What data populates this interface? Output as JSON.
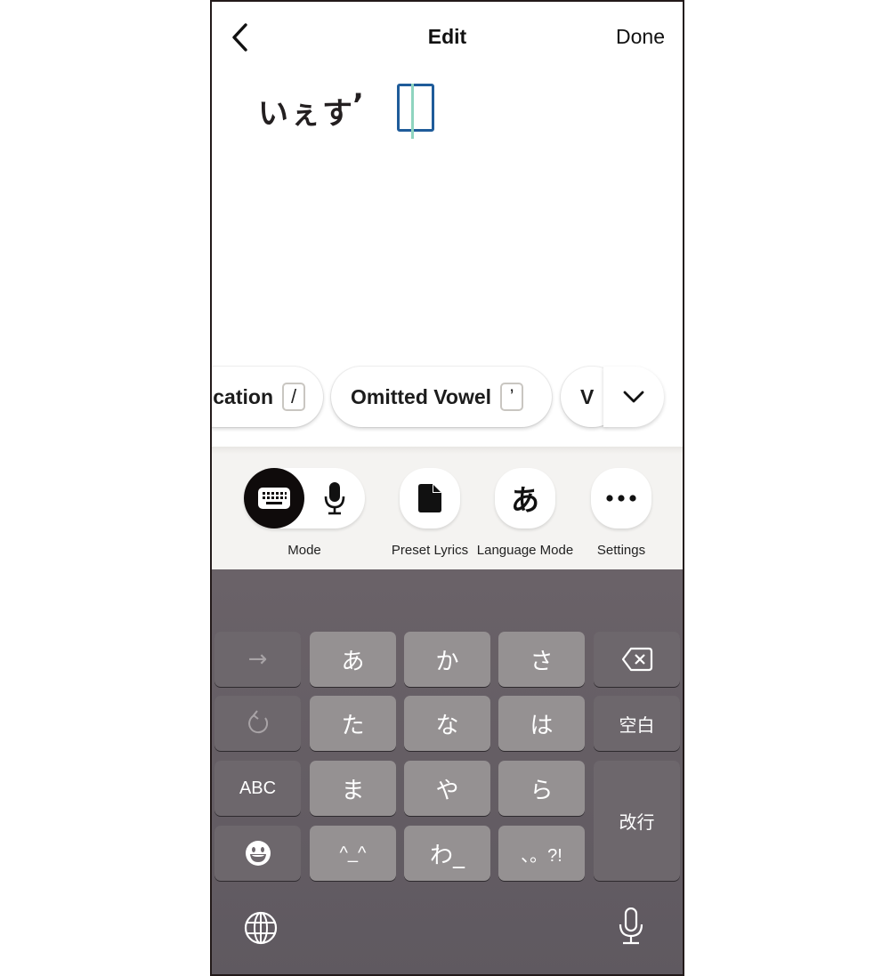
{
  "header": {
    "back_icon": "chevron-left-icon",
    "title": "Edit",
    "done_label": "Done"
  },
  "editor": {
    "lyric_text": "いぇす",
    "inserted_mark": "’"
  },
  "chips": [
    {
      "label": "cation",
      "key": "/",
      "partial": true
    },
    {
      "label": "Omitted Vowel",
      "key": "’"
    },
    {
      "label": "V",
      "partial": true
    }
  ],
  "chip_more_icon": "chevron-down-icon",
  "toolbar": {
    "mode": {
      "label": "Mode",
      "selected": "keyboard",
      "options": [
        "keyboard",
        "microphone"
      ]
    },
    "preset_lyrics": {
      "label": "Preset Lyrics",
      "icon": "document-icon"
    },
    "language_mode": {
      "label": "Language Mode",
      "glyph": "あ"
    },
    "settings": {
      "label": "Settings",
      "icon": "more-horizontal-icon"
    }
  },
  "keyboard": {
    "rows": [
      [
        "→",
        "あ",
        "か",
        "さ",
        "⌫"
      ],
      [
        "↺",
        "た",
        "な",
        "は",
        "空白"
      ],
      [
        "ABC",
        "ま",
        "や",
        "ら",
        "改行"
      ],
      [
        "☻",
        "^^",
        "わ_",
        "、。?!"
      ]
    ],
    "keys": {
      "next": "→",
      "a": "あ",
      "ka": "か",
      "sa": "さ",
      "undo": "↺",
      "ta": "た",
      "na": "な",
      "ha": "は",
      "space": "空白",
      "abc": "ABC",
      "ma": "ま",
      "ya": "や",
      "ra": "ら",
      "return": "改行",
      "kaomoji": "^_^",
      "wa": "わ_",
      "punct": "、。?!"
    },
    "bottom": {
      "globe_icon": "globe-icon",
      "mic_icon": "microphone-icon"
    }
  },
  "colors": {
    "cursor_box": "#1f5c9a",
    "cursor_line": "#8fd4bf",
    "toolbar_bg": "#f4f3f1",
    "keyboard_bg": "#655e64",
    "key_char": "#959192",
    "key_fn": "#6d676c"
  }
}
